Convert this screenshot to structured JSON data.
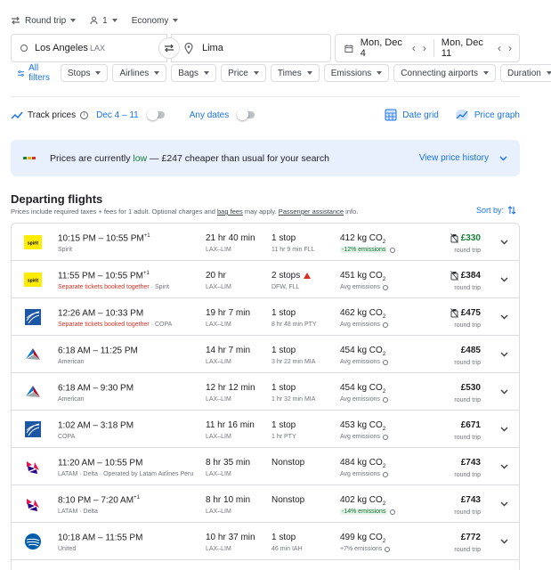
{
  "colors": {
    "accent": "#1a73e8",
    "green": "#188038",
    "red": "#d93025",
    "border": "#dadce0"
  },
  "topbar": {
    "trip_type": "Round trip",
    "passengers": "1",
    "cabin": "Economy"
  },
  "search": {
    "from": "Los Angeles",
    "from_code": "LAX",
    "to": "Lima",
    "depart_date": "Mon, Dec 4",
    "return_date": "Mon, Dec 11"
  },
  "filters": {
    "all_label": "All filters",
    "chips": [
      "Stops",
      "Airlines",
      "Bags",
      "Price",
      "Times",
      "Emissions",
      "Connecting airports",
      "Duration"
    ]
  },
  "track": {
    "label": "Track prices",
    "dates": "Dec 4 – 11",
    "any_dates": "Any dates",
    "date_grid": "Date grid",
    "price_graph": "Price graph"
  },
  "banner": {
    "prefix": "Prices are currently ",
    "level": "low",
    "suffix": " — £247 cheaper than usual for your search",
    "link": "View price history"
  },
  "section": {
    "title": "Departing flights",
    "note_a": "Prices include required taxes + fees for 1 adult. Optional charges and ",
    "note_bag": "bag fees",
    "note_b": " may apply. ",
    "note_pa": "Passenger assistance",
    "note_c": " info.",
    "sort_label": "Sort by:"
  },
  "flights": [
    {
      "times": "10:15 PM – 10:55 PM",
      "plus": "+1",
      "airline": "Spirit",
      "separate": "",
      "duration": "21 hr 40 min",
      "route": "LAX–LIM",
      "stops": "1 stop",
      "stop_detail": "11 hr 9 min FLL",
      "warn": false,
      "co2": "412 kg CO",
      "emissions": "-12% emissions",
      "emis_green": true,
      "price": "£330",
      "price_green": true,
      "bag_icon": true,
      "rt": "round trip",
      "logo": "spirit"
    },
    {
      "times": "11:55 PM – 10:55 PM",
      "plus": "+1",
      "airline": "Spirit",
      "separate": "Separate tickets booked together",
      "duration": "20 hr",
      "route": "LAX–LIM",
      "stops": "2 stops",
      "stop_detail": "DFW, FLL",
      "warn": true,
      "co2": "451 kg CO",
      "emissions": "Avg emissions",
      "emis_green": false,
      "price": "£384",
      "price_green": false,
      "bag_icon": true,
      "rt": "round trip",
      "logo": "spirit"
    },
    {
      "times": "12:26 AM – 10:33 PM",
      "plus": "",
      "airline": "COPA",
      "separate": "Separate tickets booked together",
      "duration": "19 hr 7 min",
      "route": "LAX–LIM",
      "stops": "1 stop",
      "stop_detail": "8 hr 48 min PTY",
      "warn": false,
      "co2": "462 kg CO",
      "emissions": "Avg emissions",
      "emis_green": false,
      "price": "£475",
      "price_green": false,
      "bag_icon": true,
      "rt": "round trip",
      "logo": "copa"
    },
    {
      "times": "6:18 AM – 11:25 PM",
      "plus": "",
      "airline": "American",
      "separate": "",
      "duration": "14 hr 7 min",
      "route": "LAX–LIM",
      "stops": "1 stop",
      "stop_detail": "3 hr 22 min MIA",
      "warn": false,
      "co2": "454 kg CO",
      "emissions": "Avg emissions",
      "emis_green": false,
      "price": "£485",
      "price_green": false,
      "bag_icon": false,
      "rt": "round trip",
      "logo": "american"
    },
    {
      "times": "6:18 AM – 9:30 PM",
      "plus": "",
      "airline": "American",
      "separate": "",
      "duration": "12 hr 12 min",
      "route": "LAX–LIM",
      "stops": "1 stop",
      "stop_detail": "1 hr 32 min MIA",
      "warn": false,
      "co2": "454 kg CO",
      "emissions": "Avg emissions",
      "emis_green": false,
      "price": "£530",
      "price_green": false,
      "bag_icon": false,
      "rt": "round trip",
      "logo": "american"
    },
    {
      "times": "1:02 AM – 3:18 PM",
      "plus": "",
      "airline": "COPA",
      "separate": "",
      "duration": "11 hr 16 min",
      "route": "LAX–LIM",
      "stops": "1 stop",
      "stop_detail": "1 hr PTY",
      "warn": false,
      "co2": "453 kg CO",
      "emissions": "Avg emissions",
      "emis_green": false,
      "price": "£671",
      "price_green": false,
      "bag_icon": false,
      "rt": "round trip",
      "logo": "copa"
    },
    {
      "times": "11:20 AM – 10:55 PM",
      "plus": "",
      "airline": "LATAM · Delta · Operated by Latam Airlines Peru",
      "separate": "",
      "duration": "8 hr 35 min",
      "route": "LAX–LIM",
      "stops": "Nonstop",
      "stop_detail": "",
      "warn": false,
      "co2": "484 kg CO",
      "emissions": "Avg emissions",
      "emis_green": false,
      "price": "£743",
      "price_green": false,
      "bag_icon": false,
      "rt": "round trip",
      "logo": "latam"
    },
    {
      "times": "8:10 PM – 7:20 AM",
      "plus": "+1",
      "airline": "LATAM · Delta",
      "separate": "",
      "duration": "8 hr 10 min",
      "route": "LAX–LIM",
      "stops": "Nonstop",
      "stop_detail": "",
      "warn": false,
      "co2": "402 kg CO",
      "emissions": "-14% emissions",
      "emis_green": true,
      "price": "£743",
      "price_green": false,
      "bag_icon": false,
      "rt": "round trip",
      "logo": "latam"
    },
    {
      "times": "10:18 AM – 11:55 PM",
      "plus": "",
      "airline": "United",
      "separate": "",
      "duration": "10 hr 37 min",
      "route": "LAX–LIM",
      "stops": "1 stop",
      "stop_detail": "46 min IAH",
      "warn": false,
      "co2": "499 kg CO",
      "emissions": "+7% emissions",
      "emis_green": false,
      "price": "£772",
      "price_green": false,
      "bag_icon": false,
      "rt": "round trip",
      "logo": "united"
    }
  ]
}
